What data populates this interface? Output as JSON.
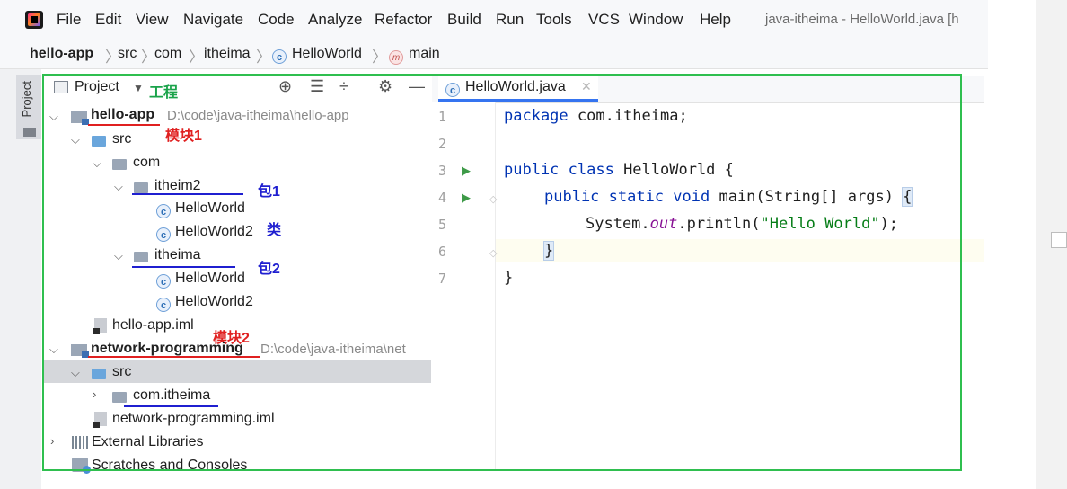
{
  "menubar": {
    "items": [
      "File",
      "Edit",
      "View",
      "Navigate",
      "Code",
      "Analyze",
      "Refactor",
      "Build",
      "Run",
      "Tools",
      "VCS",
      "Window",
      "Help"
    ],
    "window_title": "java-itheima - HelloWorld.java [h"
  },
  "breadcrumb": [
    "hello-app",
    "src",
    "com",
    "itheima",
    "HelloWorld",
    "main"
  ],
  "project_panel": {
    "title": "Project",
    "dropdown_icon": "chevron-down-icon",
    "toolbar_icons": [
      "locate-icon",
      "expand-all-icon",
      "collapse-all-icon",
      "gear-icon",
      "minimize-icon"
    ]
  },
  "tree": {
    "module1": {
      "name": "hello-app",
      "path": "D:\\code\\java-itheima\\hello-app"
    },
    "src1": "src",
    "com": "com",
    "pkg1": "itheim2",
    "class1a": "HelloWorld",
    "class1b": "HelloWorld2",
    "pkg2": "itheima",
    "class2a": "HelloWorld",
    "class2b": "HelloWorld2",
    "iml1": "hello-app.iml",
    "module2": {
      "name": "network-programming",
      "path": "D:\\code\\java-itheima\\net"
    },
    "src2": "src",
    "pkg3": "com.itheima",
    "iml2": "network-programming.iml",
    "libs": "External Libraries",
    "scratches": "Scratches and Consoles"
  },
  "annotations": {
    "project": "工程",
    "module1": "模块1",
    "package1": "包1",
    "class": "类",
    "package2": "包2",
    "module2": "模块2",
    "colors": {
      "red": "#e02020",
      "blue": "#1f1fd0",
      "green": "#1aa34a"
    }
  },
  "editor": {
    "tab": "HelloWorld.java",
    "line_numbers": [
      "1",
      "2",
      "3",
      "4",
      "5",
      "6",
      "7"
    ],
    "code": {
      "l1_kw": "package",
      "l1_rest": " com.itheima;",
      "l3_kw": "public class",
      "l3_rest": " HelloWorld {",
      "l4_kw": "public static void",
      "l4_rest": " main(String[] args) ",
      "l4_brace": "{",
      "l5_a": "System.",
      "l5_out": "out",
      "l5_b": ".println(",
      "l5_str": "\"Hello World\"",
      "l5_c": ");",
      "l6": "}",
      "l7": "}"
    }
  }
}
